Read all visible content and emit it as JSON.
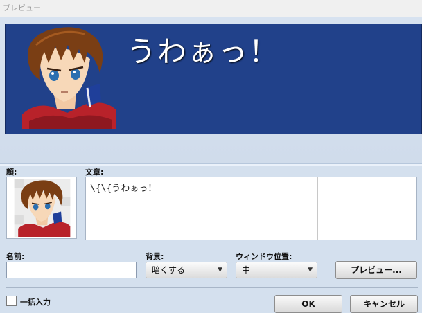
{
  "window": {
    "title": "プレビュー"
  },
  "preview": {
    "message": "うわぁっ！"
  },
  "labels": {
    "face": "顔:",
    "text": "文章:",
    "name": "名前:",
    "background": "背景:",
    "window_position": "ウィンドウ位置:"
  },
  "text_field": {
    "value": "\\{\\{うわぁっ！"
  },
  "name_field": {
    "value": ""
  },
  "background_select": {
    "value": "暗くする"
  },
  "window_position_select": {
    "value": "中"
  },
  "buttons": {
    "preview": "プレビュー...",
    "ok": "OK",
    "cancel": "キャンセル"
  },
  "batch_input": {
    "label": "一括入力",
    "checked": false
  },
  "colors": {
    "message_window_bg": "#21418a",
    "panel_bg": "#d4e0ee"
  }
}
